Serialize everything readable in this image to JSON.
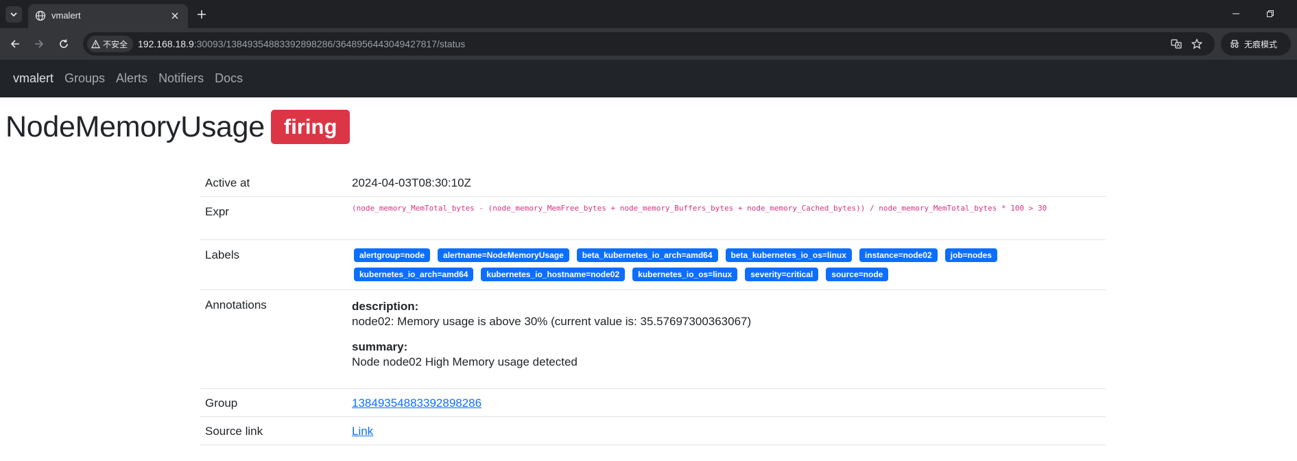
{
  "browser": {
    "tab_title": "vmalert",
    "url_host": "192.168.18.9",
    "url_rest": ":30093/13849354883392898286/3648956443049427817/status",
    "security_label": "不安全",
    "incognito_label": "无痕模式"
  },
  "navbar": {
    "brand": "vmalert",
    "links": [
      "Groups",
      "Alerts",
      "Notifiers",
      "Docs"
    ]
  },
  "alert": {
    "name": "NodeMemoryUsage",
    "state": "firing",
    "active_at_label": "Active at",
    "active_at": "2024-04-03T08:30:10Z",
    "expr_label": "Expr",
    "expr": "(node_memory_MemTotal_bytes - (node_memory_MemFree_bytes + node_memory_Buffers_bytes + node_memory_Cached_bytes)) / node_memory_MemTotal_bytes * 100 > 30",
    "labels_label": "Labels",
    "labels": [
      "alertgroup=node",
      "alertname=NodeMemoryUsage",
      "beta_kubernetes_io_arch=amd64",
      "beta_kubernetes_io_os=linux",
      "instance=node02",
      "job=nodes",
      "kubernetes_io_arch=amd64",
      "kubernetes_io_hostname=node02",
      "kubernetes_io_os=linux",
      "severity=critical",
      "source=node"
    ],
    "annotations_label": "Annotations",
    "annotations": [
      {
        "key": "description:",
        "value": "node02: Memory usage is above 30% (current value is: 35.57697300363067)"
      },
      {
        "key": "summary:",
        "value": "Node node02 High Memory usage detected"
      }
    ],
    "group_label": "Group",
    "group": "13849354883392898286",
    "source_label": "Source link",
    "source": "Link"
  },
  "colors": {
    "firing": "#dc3545",
    "label_badge": "#0d6efd",
    "expr_text": "#d63384",
    "navbar_bg": "#212529"
  }
}
